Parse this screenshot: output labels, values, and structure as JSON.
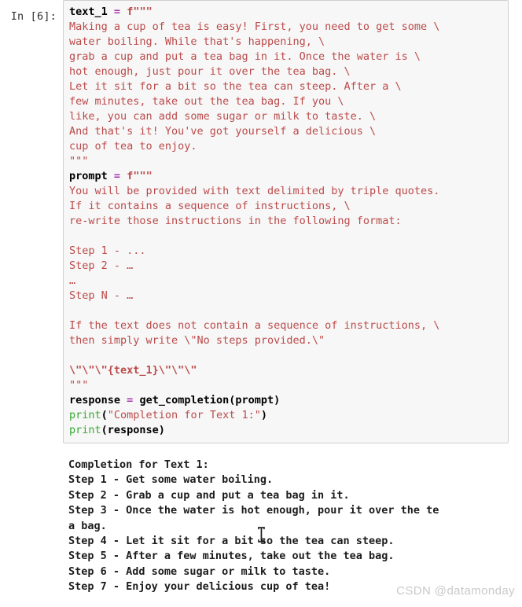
{
  "notebook": {
    "cell": {
      "prompt_label": "In [6]:",
      "execution_count": 6,
      "cell_type": "code",
      "language": "python",
      "source_lines": [
        {
          "tokens": [
            {
              "t": "text_1",
              "c": "name"
            },
            {
              "t": " ",
              "c": "plain"
            },
            {
              "t": "=",
              "c": "op"
            },
            {
              "t": " ",
              "c": "plain"
            },
            {
              "t": "f\"\"\"",
              "c": "strb"
            }
          ]
        },
        {
          "tokens": [
            {
              "t": "Making a cup of tea is easy! First, you need to get some \\",
              "c": "str"
            }
          ]
        },
        {
          "tokens": [
            {
              "t": "water boiling. While that's happening, \\",
              "c": "str"
            }
          ]
        },
        {
          "tokens": [
            {
              "t": "grab a cup and put a tea bag in it. Once the water is \\",
              "c": "str"
            }
          ]
        },
        {
          "tokens": [
            {
              "t": "hot enough, just pour it over the tea bag. \\",
              "c": "str"
            }
          ]
        },
        {
          "tokens": [
            {
              "t": "Let it sit for a bit so the tea can steep. After a \\",
              "c": "str"
            }
          ]
        },
        {
          "tokens": [
            {
              "t": "few minutes, take out the tea bag. If you \\",
              "c": "str"
            }
          ]
        },
        {
          "tokens": [
            {
              "t": "like, you can add some sugar or milk to taste. \\",
              "c": "str"
            }
          ]
        },
        {
          "tokens": [
            {
              "t": "And that's it! You've got yourself a delicious \\",
              "c": "str"
            }
          ]
        },
        {
          "tokens": [
            {
              "t": "cup of tea to enjoy.",
              "c": "str"
            }
          ]
        },
        {
          "tokens": [
            {
              "t": "\"\"\"",
              "c": "str"
            }
          ]
        },
        {
          "tokens": [
            {
              "t": "prompt",
              "c": "name"
            },
            {
              "t": " ",
              "c": "plain"
            },
            {
              "t": "=",
              "c": "op"
            },
            {
              "t": " ",
              "c": "plain"
            },
            {
              "t": "f\"\"\"",
              "c": "strb"
            }
          ]
        },
        {
          "tokens": [
            {
              "t": "You will be provided with text delimited by triple quotes.",
              "c": "str"
            }
          ]
        },
        {
          "tokens": [
            {
              "t": "If it contains a sequence of instructions, \\",
              "c": "str"
            }
          ]
        },
        {
          "tokens": [
            {
              "t": "re-write those instructions in the following format:",
              "c": "str"
            }
          ]
        },
        {
          "tokens": [
            {
              "t": "",
              "c": "str"
            }
          ]
        },
        {
          "tokens": [
            {
              "t": "Step 1 - ...",
              "c": "str"
            }
          ]
        },
        {
          "tokens": [
            {
              "t": "Step 2 - …",
              "c": "str"
            }
          ]
        },
        {
          "tokens": [
            {
              "t": "…",
              "c": "ell"
            }
          ]
        },
        {
          "tokens": [
            {
              "t": "Step N - …",
              "c": "str"
            }
          ]
        },
        {
          "tokens": [
            {
              "t": "",
              "c": "str"
            }
          ]
        },
        {
          "tokens": [
            {
              "t": "If the text does not contain a sequence of instructions, \\",
              "c": "str"
            }
          ]
        },
        {
          "tokens": [
            {
              "t": "then simply write \\\"No steps provided.\\\"",
              "c": "str"
            }
          ]
        },
        {
          "tokens": [
            {
              "t": "",
              "c": "str"
            }
          ]
        },
        {
          "tokens": [
            {
              "t": "\\\"\\\"\\\"{text_1}\\\"\\\"\\\"",
              "c": "strb"
            }
          ]
        },
        {
          "tokens": [
            {
              "t": "\"\"\"",
              "c": "str"
            }
          ]
        },
        {
          "tokens": [
            {
              "t": "response",
              "c": "name"
            },
            {
              "t": " ",
              "c": "plain"
            },
            {
              "t": "=",
              "c": "op"
            },
            {
              "t": " ",
              "c": "plain"
            },
            {
              "t": "get_completion(prompt)",
              "c": "name"
            }
          ]
        },
        {
          "tokens": [
            {
              "t": "print",
              "c": "builtin"
            },
            {
              "t": "(",
              "c": "name"
            },
            {
              "t": "\"Completion for Text 1:\"",
              "c": "str"
            },
            {
              "t": ")",
              "c": "name"
            }
          ]
        },
        {
          "tokens": [
            {
              "t": "print",
              "c": "builtin"
            },
            {
              "t": "(response)",
              "c": "name"
            }
          ]
        }
      ]
    },
    "output": {
      "stream_name": "stdout",
      "lines": [
        "Completion for Text 1:",
        "Step 1 - Get some water boiling.",
        "Step 2 - Grab a cup and put a tea bag in it.",
        "Step 3 - Once the water is hot enough, pour it over the te",
        "a bag.",
        "Step 4 - Let it sit for a bit so the tea can steep.",
        "Step 5 - After a few minutes, take out the tea bag.",
        "Step 6 - Add some sugar or milk to taste.",
        "Step 7 - Enjoy your delicious cup of tea!"
      ]
    }
  },
  "watermark": {
    "text": "CSDN @datamonday"
  },
  "colors": {
    "cell_background": "#f7f7f7",
    "cell_border": "#cfcfcf",
    "page_background": "#ffffff",
    "string_token": "#bb4a4a",
    "operator_token": "#a535ae",
    "builtin_token": "#36a832",
    "name_token": "#000000",
    "output_text": "#1c1c1c",
    "watermark_text": "#c9c9c9"
  }
}
